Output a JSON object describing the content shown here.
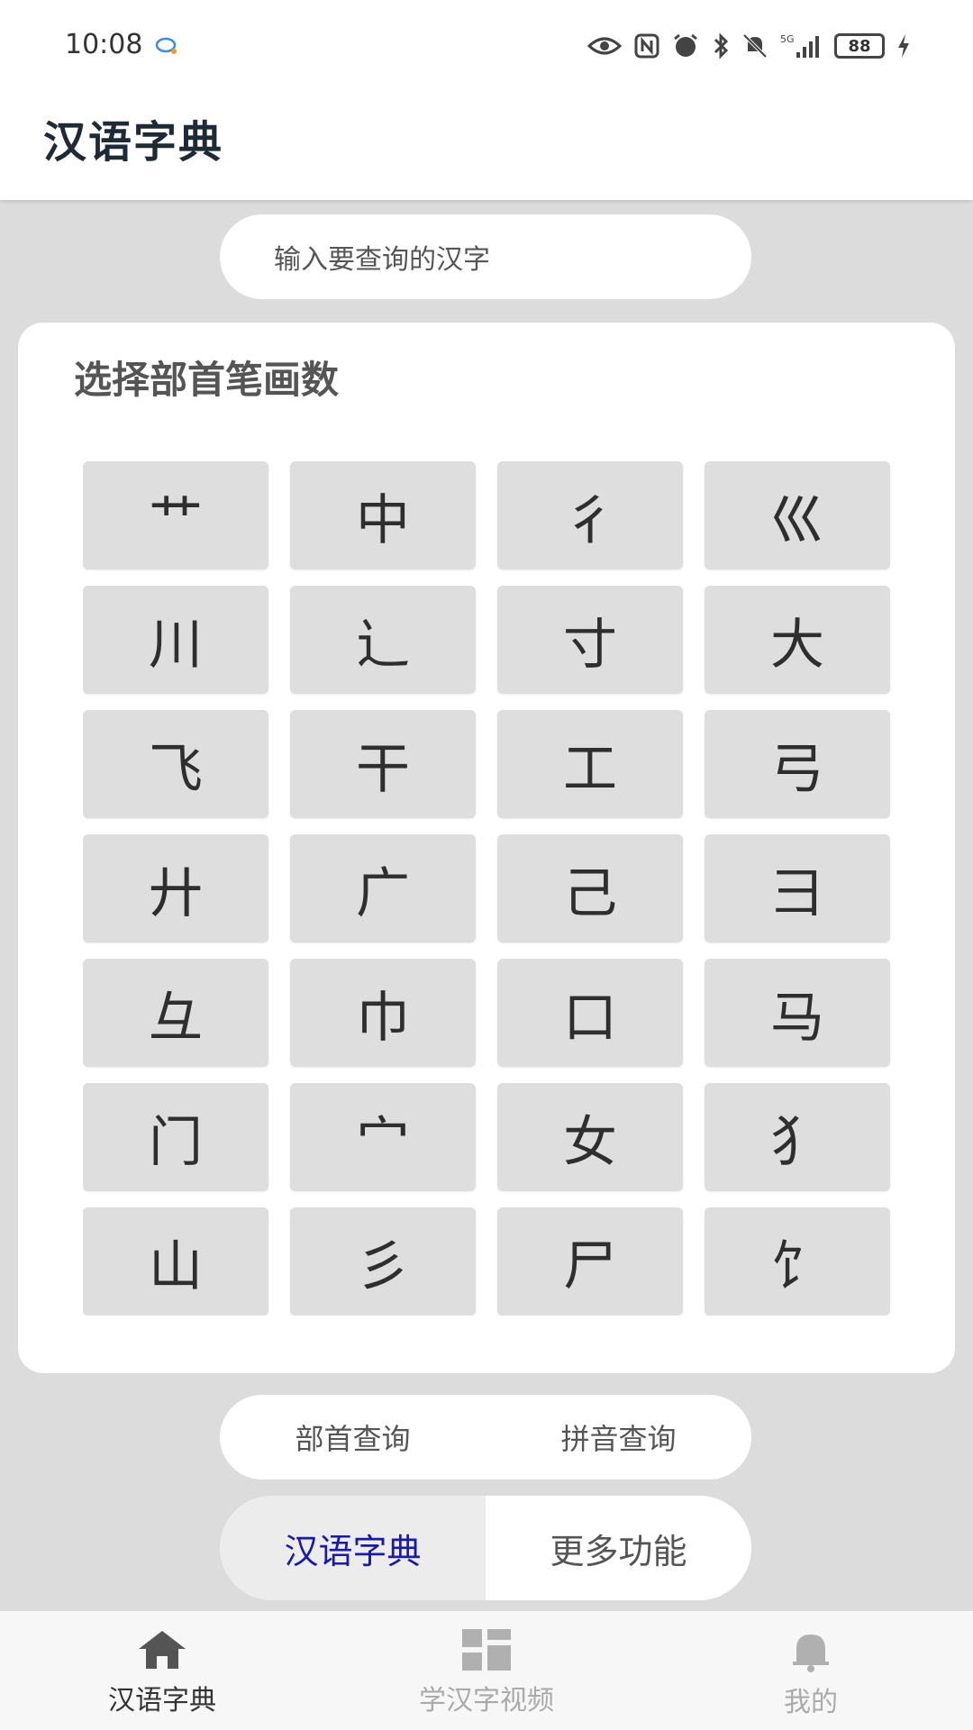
{
  "status": {
    "time": "10:08",
    "battery": "88",
    "signal_label": "5G"
  },
  "app_bar": {
    "title": "汉语字典"
  },
  "search": {
    "placeholder": "输入要查询的汉字"
  },
  "card": {
    "title": "选择部首笔画数",
    "radicals": [
      "艹",
      "中",
      "彳",
      "巛",
      "川",
      "辶",
      "寸",
      "大",
      "飞",
      "干",
      "工",
      "弓",
      "廾",
      "广",
      "己",
      "彐",
      "彑",
      "巾",
      "口",
      "马",
      "门",
      "宀",
      "女",
      "犭",
      "山",
      "彡",
      "尸",
      "饣",
      "",
      "",
      "",
      ""
    ]
  },
  "query_tabs": [
    "部首查询",
    "拼音查询"
  ],
  "mode_toggle": {
    "active": "汉语字典",
    "other": "更多功能"
  },
  "bottom_nav": [
    {
      "label": "汉语字典",
      "icon": "home-icon",
      "active": true
    },
    {
      "label": "学汉字视频",
      "icon": "dashboard-icon",
      "active": false
    },
    {
      "label": "我的",
      "icon": "bell-icon",
      "active": false
    }
  ],
  "colors": {
    "accent": "#1a1aa6",
    "background": "#dcdcdc",
    "cell": "#dedede"
  }
}
